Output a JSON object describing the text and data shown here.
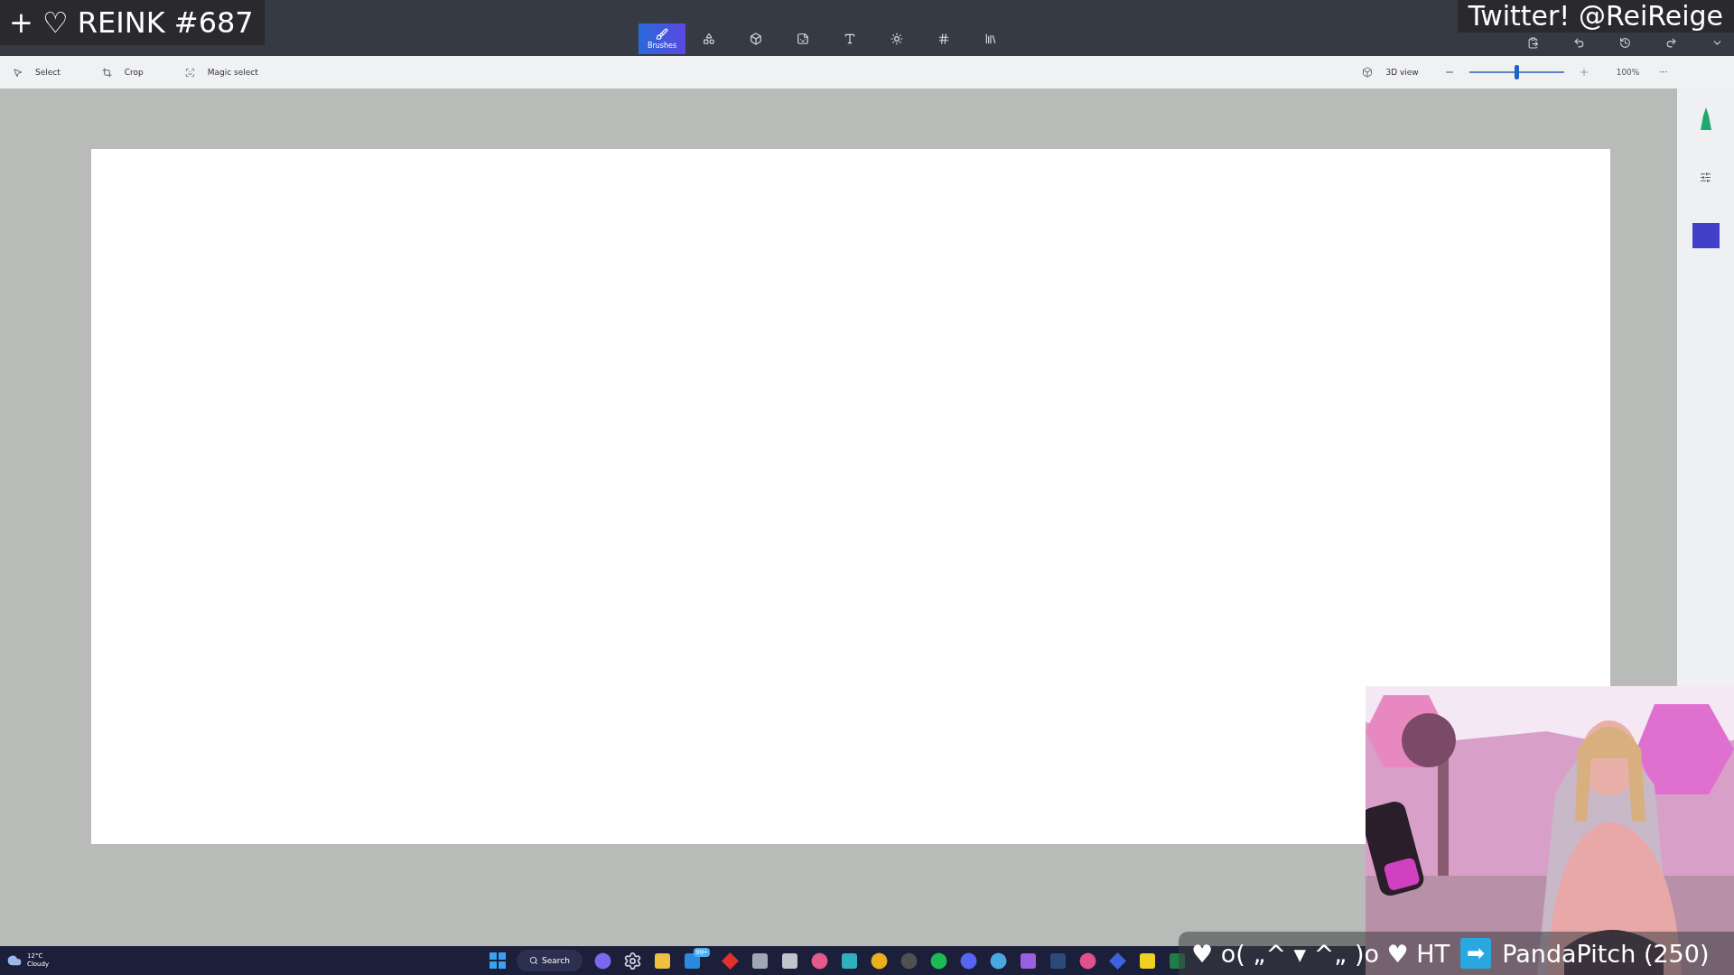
{
  "stream_overlay": {
    "episode_label": "+ ♡ REINK #687",
    "social_label": "Twitter! @ReiReige",
    "alert": {
      "prefix": "♥ o( „^ ▾ ^„ )o ♥ HT",
      "arrow": "➡",
      "name": "PandaPitch (250)"
    }
  },
  "tool_tabs": [
    {
      "kind": "brushes",
      "label": "Brushes",
      "selected": true
    },
    {
      "kind": "shapes2d",
      "selected": false
    },
    {
      "kind": "shapes3d",
      "selected": false
    },
    {
      "kind": "stickers",
      "selected": false
    },
    {
      "kind": "text",
      "selected": false
    },
    {
      "kind": "effects",
      "selected": false
    },
    {
      "kind": "canvas",
      "selected": false
    },
    {
      "kind": "library",
      "selected": false
    }
  ],
  "toolbar": {
    "tools": [
      {
        "kind": "select",
        "label": "Select"
      },
      {
        "kind": "crop",
        "label": "Crop"
      },
      {
        "kind": "magic",
        "label": "Magic select"
      }
    ],
    "view_3d": "3D view",
    "zoom": {
      "level": 0.5,
      "reading": "100%"
    },
    "more": "···"
  },
  "taskbar": {
    "weather": {
      "temperature": "12°C",
      "condition": "Cloudy"
    },
    "search": "Search",
    "apps": [
      {
        "kind": "circle",
        "color": "#7b68ee"
      },
      {
        "kind": "gear",
        "color": "#c8d0e0"
      },
      {
        "kind": "square",
        "color": "#f0c040"
      },
      {
        "kind": "square",
        "color": "#2a8ae0",
        "badge": "99+"
      },
      {
        "kind": "diamond",
        "color": "#e03030"
      },
      {
        "kind": "square",
        "color": "#a0a8b8"
      },
      {
        "kind": "square",
        "color": "#c0c4cc"
      },
      {
        "kind": "circle",
        "color": "#e05a8a"
      },
      {
        "kind": "square",
        "color": "#30b0c0"
      },
      {
        "kind": "circle",
        "color": "#e8b020"
      },
      {
        "kind": "circle",
        "color": "#505050"
      },
      {
        "kind": "circle",
        "color": "#1db954"
      },
      {
        "kind": "circle",
        "color": "#5865f2"
      },
      {
        "kind": "circle",
        "color": "#4aa8e0"
      },
      {
        "kind": "square",
        "color": "#9a60e0"
      },
      {
        "kind": "square",
        "color": "#2a4a7a"
      },
      {
        "kind": "circle",
        "color": "#e0508a"
      },
      {
        "kind": "diamond",
        "color": "#4060e0"
      },
      {
        "kind": "square",
        "color": "#f0d020"
      },
      {
        "kind": "square",
        "color": "#1e7e45"
      }
    ]
  }
}
